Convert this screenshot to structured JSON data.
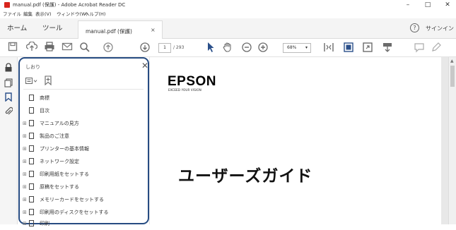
{
  "window": {
    "title": "manual.pdf (保護) - Adobe Acrobat Reader DC",
    "controls": {
      "minimize": "–",
      "maximize": "□",
      "close": "✕"
    }
  },
  "menu": [
    "ファイル",
    "編集",
    "表示(V)",
    "ウィンドウ(W)",
    "ヘルプ(H)"
  ],
  "tabs": {
    "home": "ホーム",
    "tools": "ツール",
    "document": "manual.pdf (保護)",
    "close": "×"
  },
  "header": {
    "help": "?",
    "signin": "サインイン"
  },
  "toolbar": {
    "current_page": "1",
    "total_pages": "/ 293",
    "zoom": "68%",
    "zoom_arrow": "▾"
  },
  "bookmarks": {
    "title": "しおり",
    "close": "✕",
    "items": [
      {
        "label": "商標",
        "expandable": false
      },
      {
        "label": "目次",
        "expandable": false
      },
      {
        "label": "マニュアルの見方",
        "expandable": true
      },
      {
        "label": "製品のご注意",
        "expandable": true
      },
      {
        "label": "プリンターの基本情報",
        "expandable": true
      },
      {
        "label": "ネットワーク設定",
        "expandable": true
      },
      {
        "label": "印刷用紙をセットする",
        "expandable": true
      },
      {
        "label": "原稿をセットする",
        "expandable": true
      },
      {
        "label": "メモリーカードをセットする",
        "expandable": true
      },
      {
        "label": "印刷用のディスクをセットする",
        "expandable": true
      },
      {
        "label": "印刷",
        "expandable": true
      }
    ]
  },
  "document": {
    "logo": "EPSON",
    "tagline": "EXCEED YOUR VISION",
    "heading": "ユーザーズガイド"
  },
  "colors": {
    "accent": "#274c82",
    "brand_red": "#d8251d"
  }
}
